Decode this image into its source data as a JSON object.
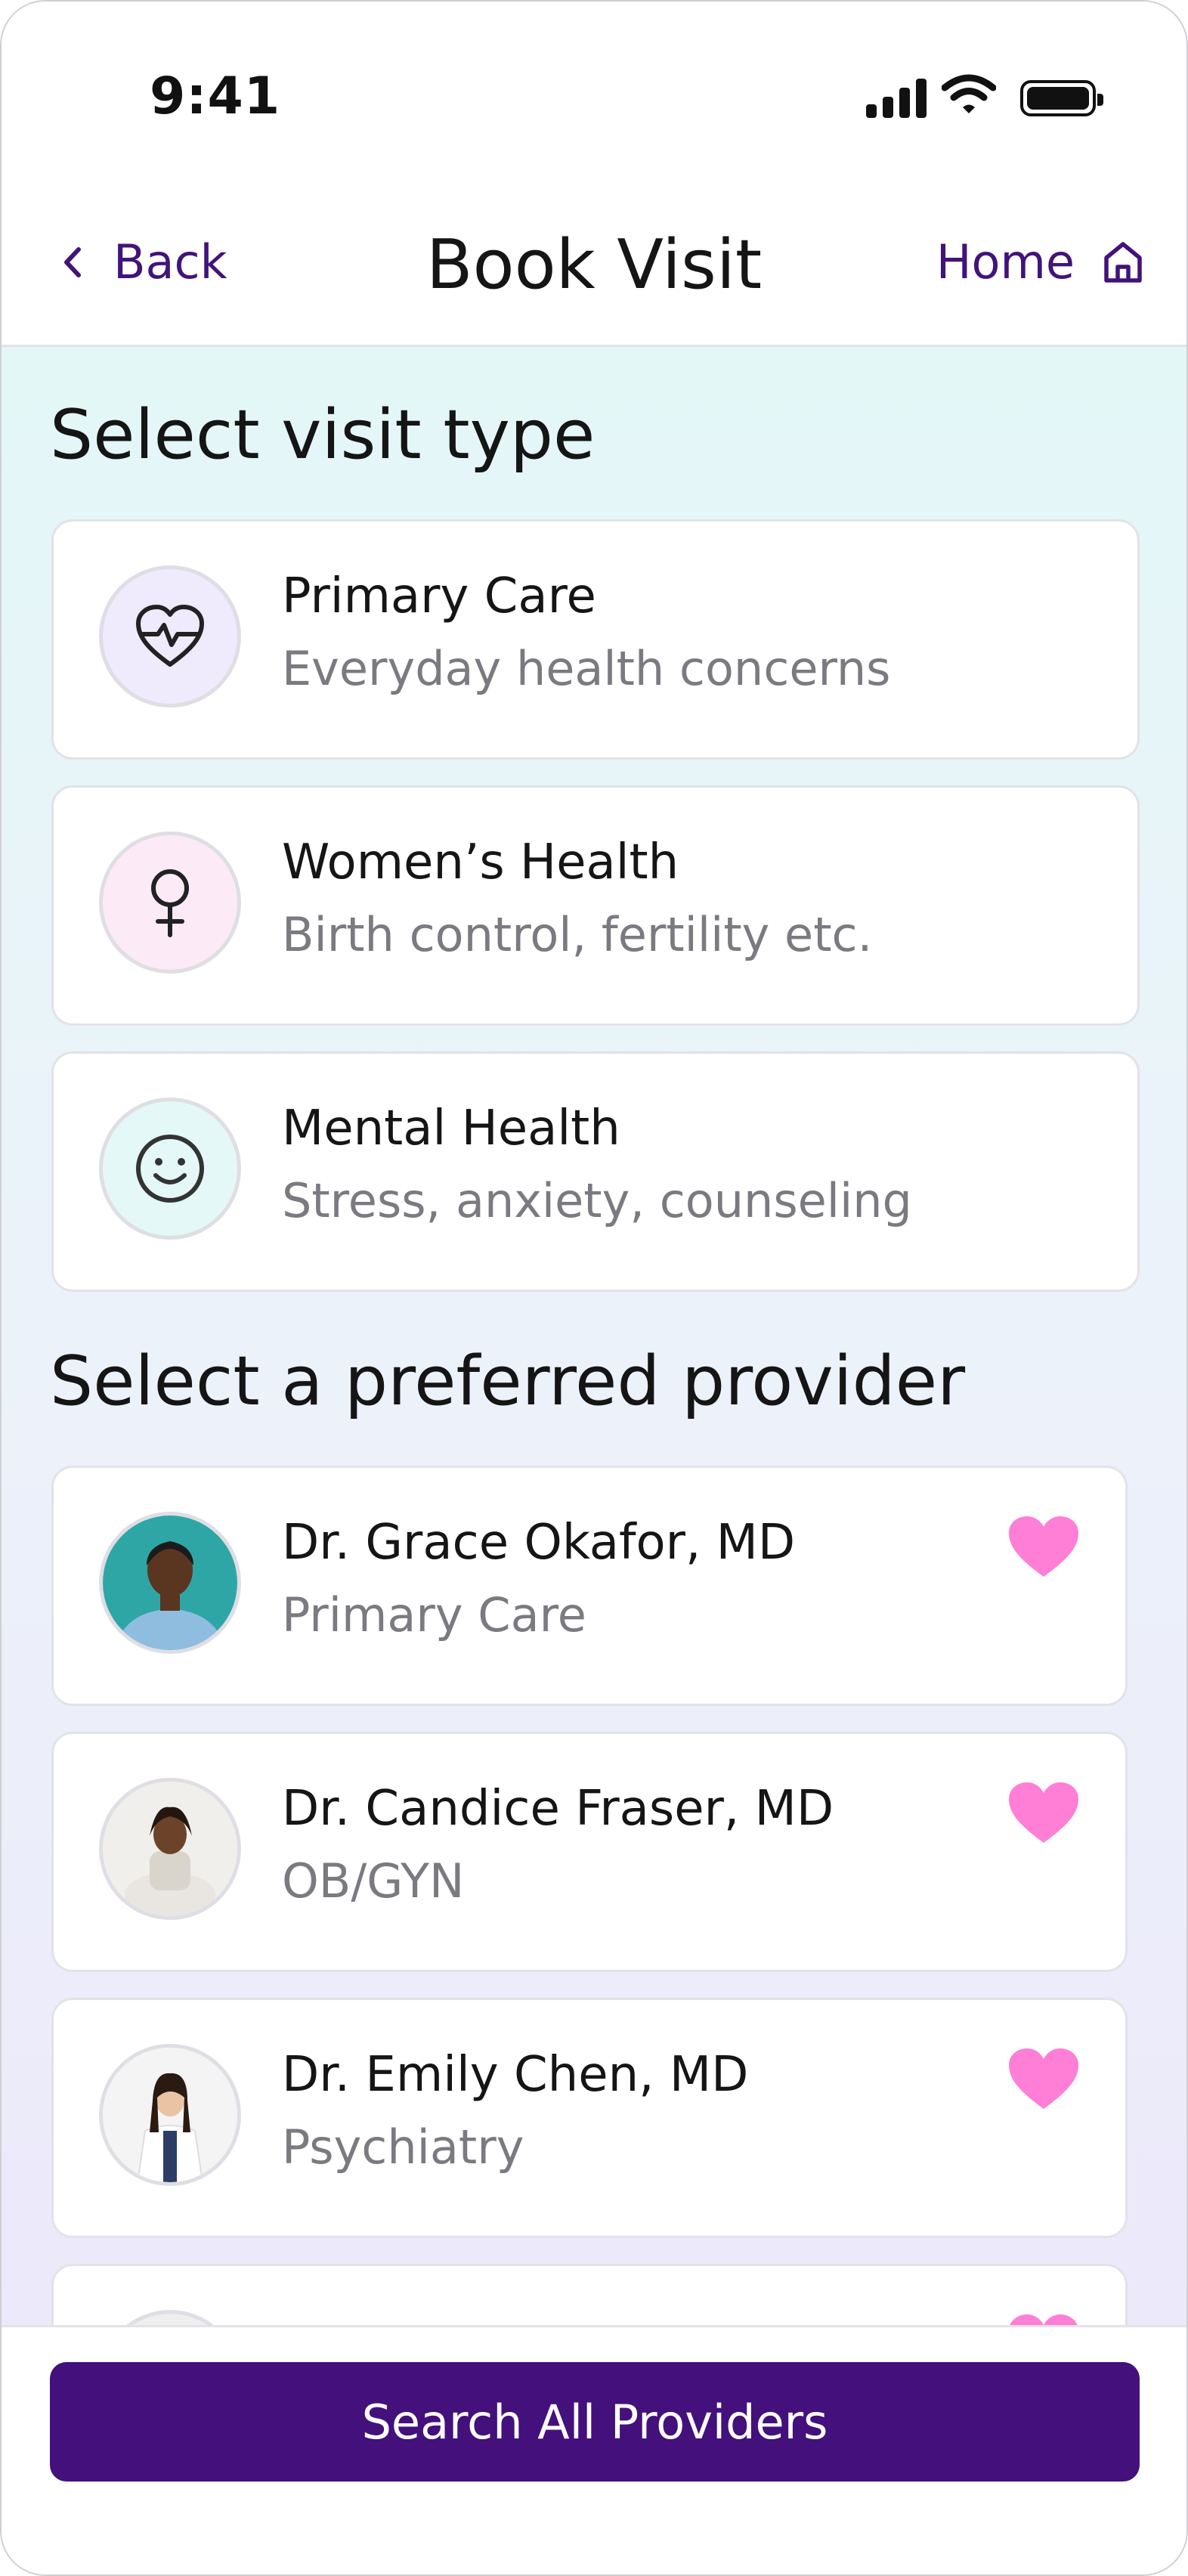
{
  "status_bar": {
    "time": "9:41"
  },
  "nav": {
    "back_label": "Back",
    "title": "Book Visit",
    "home_label": "Home"
  },
  "visit_types": {
    "heading": "Select visit type",
    "items": [
      {
        "title": "Primary Care",
        "subtitle": "Everyday health concerns",
        "icon": "heart-pulse-icon",
        "tint": "#efeafc"
      },
      {
        "title": "Women’s Health",
        "subtitle": "Birth control, fertility etc.",
        "icon": "female-symbol-icon",
        "tint": "#fcebf6"
      },
      {
        "title": "Mental Health",
        "subtitle": "Stress, anxiety, counseling",
        "icon": "smiley-face-icon",
        "tint": "#e4f8f8"
      }
    ]
  },
  "providers": {
    "heading": "Select a preferred provider",
    "items": [
      {
        "name": "Dr. Grace Okafor, MD",
        "specialty": "Primary Care",
        "favorite": true
      },
      {
        "name": "Dr. Candice Fraser, MD",
        "specialty": "OB/GYN",
        "favorite": true
      },
      {
        "name": "Dr. Emily Chen, MD",
        "specialty": "Psychiatry",
        "favorite": true
      }
    ]
  },
  "cta": {
    "label": "Search All Providers"
  },
  "colors": {
    "brand": "#43107c",
    "heart": "#ff7ed6"
  }
}
